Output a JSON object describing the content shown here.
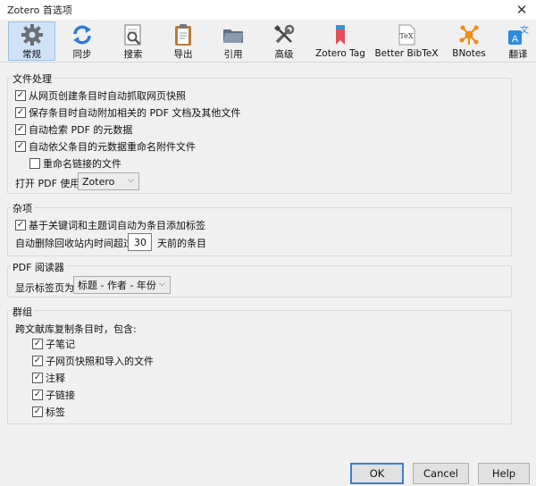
{
  "window": {
    "title": "Zotero 首选项",
    "close_glyph": "✕"
  },
  "toolbar": {
    "tabs": [
      {
        "label": "常规",
        "icon": "gear-icon",
        "active": true
      },
      {
        "label": "同步",
        "icon": "sync-icon"
      },
      {
        "label": "搜索",
        "icon": "search-icon"
      },
      {
        "label": "导出",
        "icon": "clipboard-icon"
      },
      {
        "label": "引用",
        "icon": "folder-icon"
      },
      {
        "label": "高级",
        "icon": "tools-icon"
      },
      {
        "label": "Zotero Tag",
        "icon": "bookmark-icon"
      },
      {
        "label": "Better BibTeX",
        "icon": "tex-icon",
        "icon_text": "TeX"
      },
      {
        "label": "BNotes",
        "icon": "network-icon"
      },
      {
        "label": "翻译",
        "icon": "translate-icon",
        "icon_text": "A",
        "icon_text2": "文"
      }
    ]
  },
  "file_handling": {
    "title": "文件处理",
    "options": [
      {
        "label": "从网页创建条目时自动抓取网页快照",
        "checked": true
      },
      {
        "label": "保存条目时自动附加相关的 PDF 文档及其他文件",
        "checked": true
      },
      {
        "label": "自动检索 PDF 的元数据",
        "checked": true
      },
      {
        "label": "自动依父条目的元数据重命名附件文件",
        "checked": true
      },
      {
        "label": "重命名链接的文件",
        "checked": false
      }
    ],
    "open_pdf_label": "打开 PDF 使用",
    "open_pdf_value": "Zotero"
  },
  "misc": {
    "title": "杂项",
    "auto_tag_label": "基于关键词和主题词自动为条目添加标签",
    "auto_tag_checked": true,
    "trash_prefix": "自动删除回收站内时间超过",
    "trash_days": "30",
    "trash_suffix": "天前的条目"
  },
  "pdf_reader": {
    "title": "PDF 阅读器",
    "tab_title_label": "显示标签页为",
    "tab_title_value": "标题 - 作者 - 年份"
  },
  "groups": {
    "title": "群组",
    "copy_label": "跨文献库复制条目时，包含:",
    "options": [
      {
        "label": "子笔记",
        "checked": true
      },
      {
        "label": "子网页快照和导入的文件",
        "checked": true
      },
      {
        "label": "注释",
        "checked": true
      },
      {
        "label": "子链接",
        "checked": true
      },
      {
        "label": "标签",
        "checked": true
      }
    ]
  },
  "buttons": {
    "ok": "OK",
    "cancel": "Cancel",
    "help": "Help"
  },
  "colors": {
    "accent": "#3c7fd0",
    "active_tab": "#cfe2f7"
  },
  "glyphs": {
    "check": "✓",
    "dropdown": "⌵"
  }
}
